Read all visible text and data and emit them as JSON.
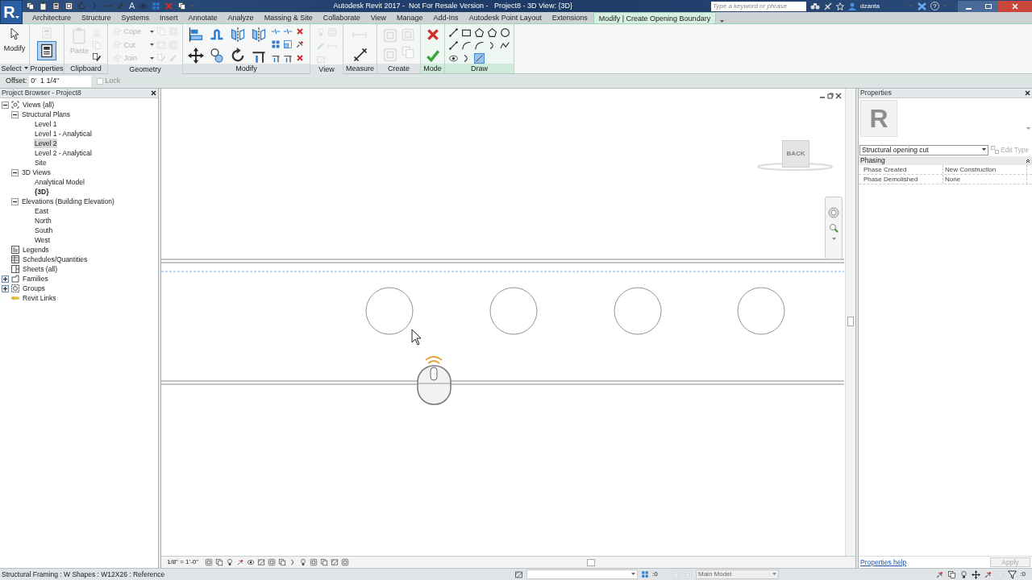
{
  "app": {
    "logo": "R",
    "annotate_glyph": "A",
    "title": "Autodesk Revit 2017 -  Not For Resale Version -   Project8 - 3D View: {3D}",
    "search": {
      "placeholder": "Type a keyword or phrase"
    },
    "user": "dzanta",
    "help_glyph": "?"
  },
  "ribbon_tabs": [
    {
      "label": "Architecture",
      "selected": false
    },
    {
      "label": "Structure",
      "selected": false
    },
    {
      "label": "Systems",
      "selected": false
    },
    {
      "label": "Insert",
      "selected": false
    },
    {
      "label": "Annotate",
      "selected": false
    },
    {
      "label": "Analyze",
      "selected": false
    },
    {
      "label": "Massing & Site",
      "selected": false
    },
    {
      "label": "Collaborate",
      "selected": false
    },
    {
      "label": "View",
      "selected": false
    },
    {
      "label": "Manage",
      "selected": false
    },
    {
      "label": "Add-Ins",
      "selected": false
    },
    {
      "label": "Autodesk Point Layout",
      "selected": false
    },
    {
      "label": "Extensions",
      "selected": false
    },
    {
      "label": "Modify | Create Opening Boundary",
      "selected": true
    }
  ],
  "ribbon_panels": [
    {
      "label": "Select",
      "dropdown": true,
      "contextual": false,
      "buttons": [
        {
          "label": "Modify",
          "disabled": false
        }
      ]
    },
    {
      "label": "Properties",
      "contextual": false,
      "on": true
    },
    {
      "label": "Clipboard",
      "contextual": false,
      "buttons": [
        {
          "label": "Paste",
          "disabled": true
        }
      ]
    },
    {
      "label": "Geometry",
      "contextual": false,
      "buttons": [
        {
          "label": "Cope",
          "disabled": true
        },
        {
          "label": "Cut",
          "disabled": true
        },
        {
          "label": "Join",
          "disabled": true
        }
      ]
    },
    {
      "label": "Modify",
      "contextual": false
    },
    {
      "label": "View",
      "contextual": false
    },
    {
      "label": "Measure",
      "contextual": false
    },
    {
      "label": "Create",
      "contextual": false
    },
    {
      "label": "Mode",
      "contextual": true
    },
    {
      "label": "Draw",
      "contextual": true
    }
  ],
  "options_bar": {
    "offset_label": "Offset:",
    "offset_value": "0'  1 1/4\"",
    "lock": {
      "label": "Lock",
      "checked": false,
      "disabled": true
    }
  },
  "project_browser": {
    "title": "Project Browser - Project8",
    "tree": [
      {
        "label": "Views (all)",
        "expanded": true,
        "selected": false,
        "children": [
          {
            "label": "Structural Plans",
            "expanded": true,
            "selected": false,
            "children": [
              {
                "label": "Level 1",
                "selected": false,
                "open": false
              },
              {
                "label": "Level 1 - Analytical",
                "selected": false,
                "open": false
              },
              {
                "label": "Level 2",
                "selected": true,
                "open": false
              },
              {
                "label": "Level 2 - Analytical",
                "selected": false,
                "open": false
              },
              {
                "label": "Site",
                "selected": false,
                "open": false
              }
            ]
          },
          {
            "label": "3D Views",
            "expanded": true,
            "selected": false,
            "children": [
              {
                "label": "Analytical Model",
                "selected": false,
                "open": false
              },
              {
                "label": "{3D}",
                "selected": false,
                "open": true
              }
            ]
          },
          {
            "label": "Elevations (Building Elevation)",
            "expanded": true,
            "selected": false,
            "children": [
              {
                "label": "East",
                "selected": false,
                "open": false
              },
              {
                "label": "North",
                "selected": false,
                "open": false
              },
              {
                "label": "South",
                "selected": false,
                "open": false
              },
              {
                "label": "West",
                "selected": false,
                "open": false
              }
            ]
          }
        ]
      },
      {
        "label": "Legends",
        "selected": false,
        "open": false
      },
      {
        "label": "Schedules/Quantities",
        "selected": false,
        "open": false
      },
      {
        "label": "Sheets (all)",
        "selected": false,
        "open": false
      },
      {
        "label": "Families",
        "expanded": false,
        "selected": false
      },
      {
        "label": "Groups",
        "expanded": false,
        "selected": false
      },
      {
        "label": "Revit Links",
        "selected": false,
        "open": false
      }
    ]
  },
  "view": {
    "viewcube_face": "BACK",
    "scale": "1/8\" = 1'-0\""
  },
  "properties": {
    "title": "Properties",
    "thumbnail_letter": "R",
    "type": "Structural opening cut",
    "edit_type": {
      "label": "Edit Type",
      "disabled": true
    },
    "category": "Phasing",
    "rows": [
      {
        "name": "Phase Created",
        "value": "New Construction"
      },
      {
        "name": "Phase Demolished",
        "value": "None"
      }
    ],
    "help_link": "Properties help",
    "apply": {
      "label": "Apply",
      "disabled": true
    }
  },
  "status_bar": {
    "text": "Structural Framing : W Shapes : W12X26 : Reference",
    "selection_count": ":0",
    "workset": "Main Model",
    "filter_count": ":0"
  }
}
